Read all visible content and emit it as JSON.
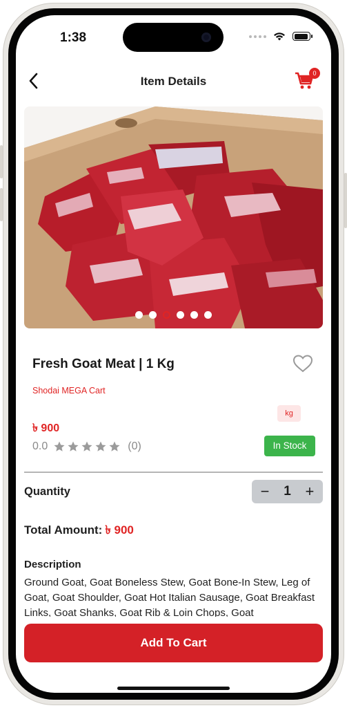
{
  "status_bar": {
    "time": "1:38"
  },
  "header": {
    "title": "Item Details",
    "cart_count": "0"
  },
  "carousel": {
    "slide_count": 6,
    "active_index": 2
  },
  "product": {
    "name": "Fresh Goat Meat | 1 Kg",
    "shop": "Shodai MEGA Cart",
    "unit": "kg",
    "price": "৳ 900",
    "rating_value": "0.0",
    "stars": 5,
    "review_count": "(0)",
    "stock_status": "In Stock"
  },
  "quantity": {
    "label": "Quantity",
    "value": "1",
    "minus": "−",
    "plus": "+"
  },
  "total": {
    "label": "Total Amount:",
    "value": "৳ 900"
  },
  "description": {
    "title": "Description",
    "text": "Ground Goat, Goat Boneless Stew, Goat Bone-In Stew, Leg of Goat, Goat Shoulder, Goat Hot Italian Sausage, Goat Breakfast Links, Goat Shanks, Goat Rib & Loin Chops, Goat"
  },
  "actions": {
    "add_to_cart": "Add To Cart"
  },
  "colors": {
    "accent": "#e02424",
    "button": "#d42127",
    "stock": "#3cb44b"
  }
}
